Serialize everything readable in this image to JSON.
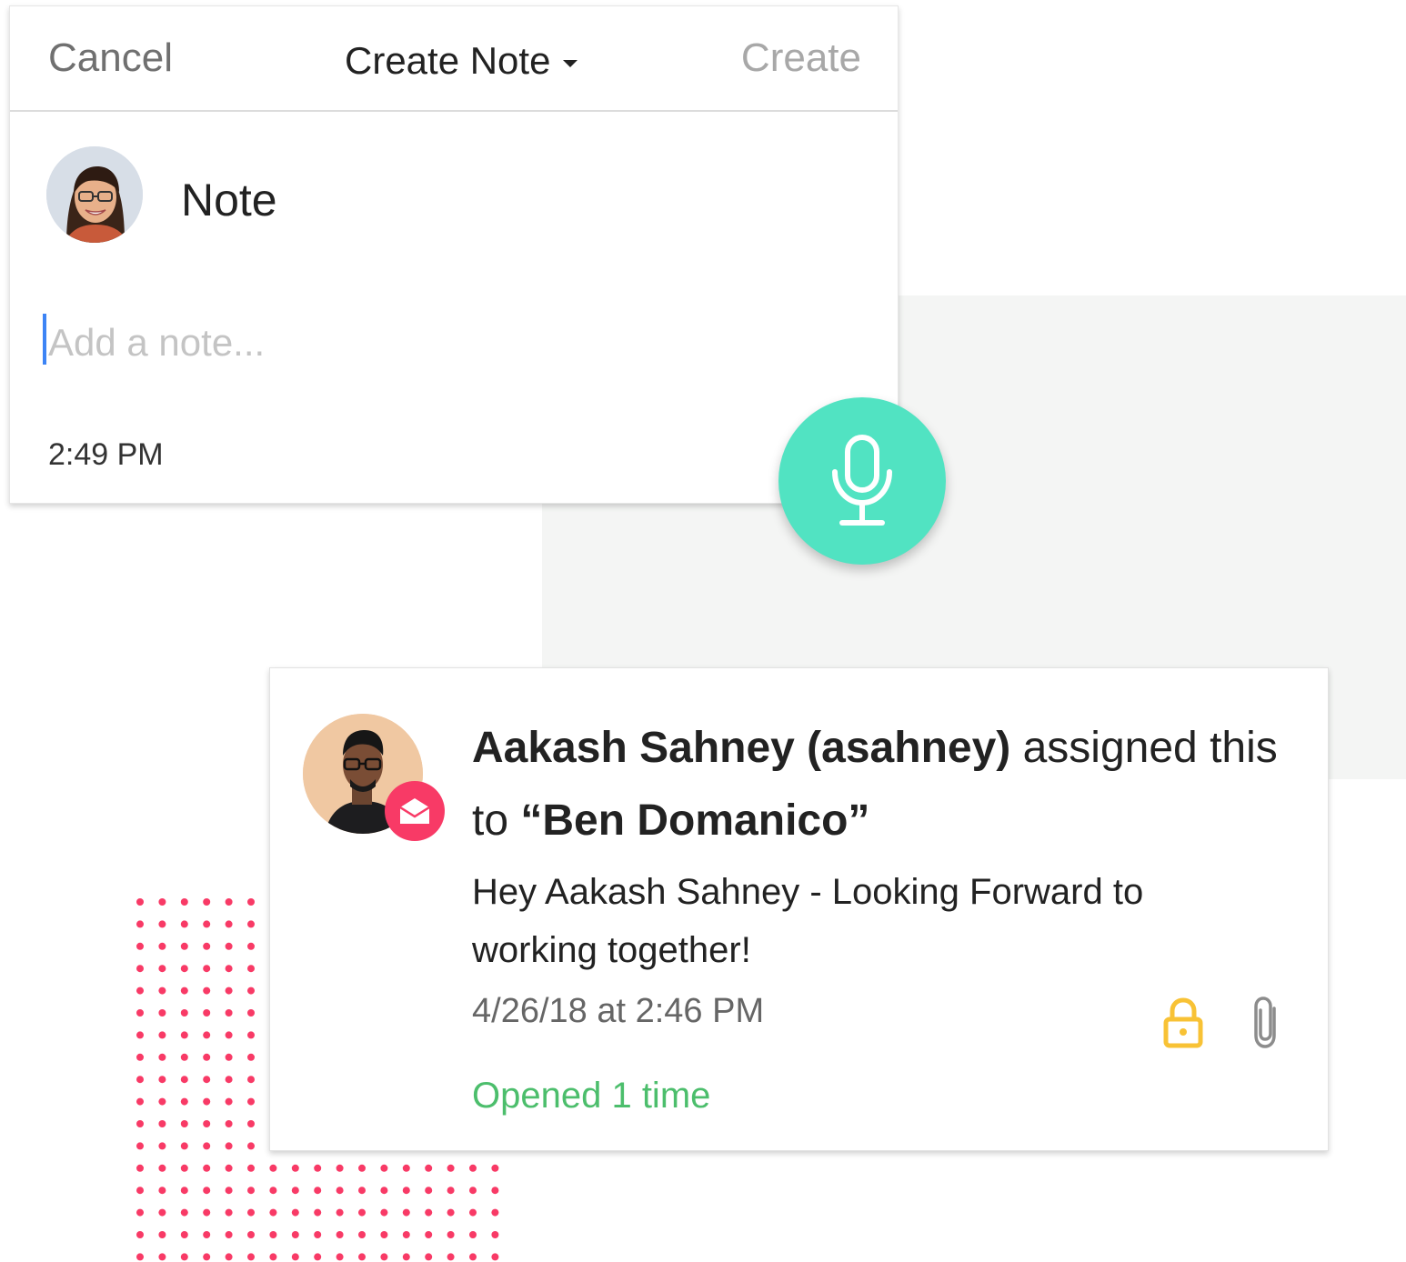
{
  "colors": {
    "accent_teal": "#51e3c2",
    "badge_pink": "#f83a66",
    "cursor_blue": "#3d84f5",
    "success_green": "#4cbe6c",
    "lock_yellow": "#f8c235",
    "dot_pink": "#f83a66",
    "panel_gray": "#f4f5f4"
  },
  "note_composer": {
    "cancel_label": "Cancel",
    "title": "Create Note",
    "title_dropdown_icon": "caret-down-icon",
    "create_label": "Create",
    "note_label": "Note",
    "input": {
      "value": "",
      "placeholder": "Add a note..."
    },
    "time": "2:49 PM"
  },
  "mic_button": {
    "icon": "microphone-icon"
  },
  "activity": {
    "assigner_name": "Aakash Sahney (asahney)",
    "assigned_text": " assigned this",
    "to_text": "to ",
    "assignee": "“Ben Domanico”",
    "badge_icon": "open-envelope-icon",
    "message": "Hey Aakash Sahney - Looking Forward to working together!",
    "timestamp": "4/26/18 at 2:46 PM",
    "status": "Opened 1 time",
    "icons": [
      "lock-icon",
      "paperclip-icon"
    ]
  }
}
